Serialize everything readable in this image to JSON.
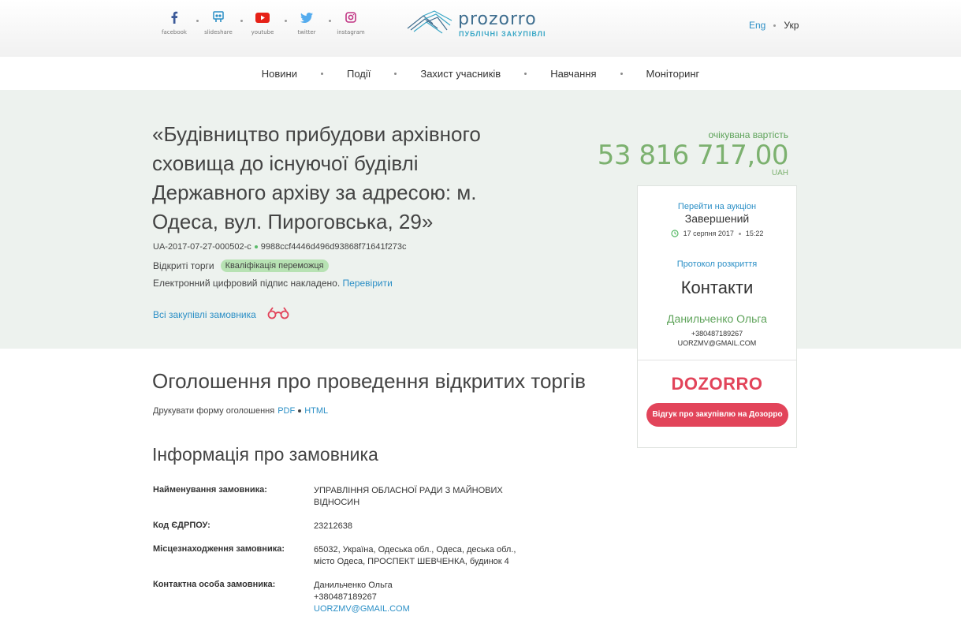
{
  "social": [
    {
      "name": "facebook",
      "label": "facebook",
      "color": "#3b5998"
    },
    {
      "name": "slideshare",
      "label": "slideshare",
      "color": "#2b8fc6"
    },
    {
      "name": "youtube",
      "label": "youtube",
      "color": "#e62117"
    },
    {
      "name": "twitter",
      "label": "twitter",
      "color": "#55acee"
    },
    {
      "name": "instagram",
      "label": "instagram",
      "color": "#c13584"
    }
  ],
  "logo": {
    "word": "prozorro",
    "subtitle": "ПУБЛІЧНІ ЗАКУПІВЛІ"
  },
  "lang": {
    "en": "Eng",
    "uk": "Укр"
  },
  "nav": [
    "Новини",
    "Події",
    "Захист учасників",
    "Навчання",
    "Моніторинг"
  ],
  "tender": {
    "title": "«Будівництво прибудови архівного сховища до існуючої будівлі Державного архіву за адресою: м. Одеса, вул. Пироговська, 29»",
    "id": "UA-2017-07-27-000502-c",
    "hash": "9988ccf4446d496d93868f71641f273c",
    "procedure": "Відкриті торги",
    "status_badge": "Кваліфікація переможця",
    "sign_text": "Електронний цифровий підпис накладено.",
    "sign_link": "Перевірити",
    "all_purchases": "Всі закупівлі замовника",
    "expected_label": "очікувана вартість",
    "expected_value": "53 816 717,00",
    "currency": "UAH"
  },
  "sidebox": {
    "auction_link": "Перейти на аукціон",
    "auction_status": "Завершений",
    "date": "17 серпня 2017",
    "time": "15:22",
    "protocol_link": "Протокол розкриття",
    "contacts_title": "Контакти",
    "contact_name": "Данильченко Ольга",
    "contact_phone": "+380487189267",
    "contact_email": "UORZMV@GMAIL.COM",
    "dozorro": "DOZORRO",
    "dozorro_button": "Відгук про закупівлю на Дозорро"
  },
  "content": {
    "announce_title": "Оголошення про проведення відкритих торгів",
    "print_label": "Друкувати форму оголошення",
    "print_pdf": "PDF",
    "print_html": "HTML",
    "info_title": "Інформація про замовника",
    "rows": [
      {
        "label": "Найменування замовника:",
        "value": "УПРАВЛІННЯ ОБЛАСНОЇ РАДИ З МАЙНОВИХ ВІДНОСИН"
      },
      {
        "label": "Код ЄДРПОУ:",
        "value": "23212638"
      },
      {
        "label": "Місцезнаходження замовника:",
        "value": "65032, Україна, Одеська обл., Одеса, деська обл., місто Одеса, ПРОСПЕКТ ШЕВЧЕНКА, будинок 4"
      },
      {
        "label": "Контактна особа замовника:",
        "value_name": "Данильченко Ольга",
        "value_phone": "+380487189267",
        "value_email": "UORZMV@GMAIL.COM"
      }
    ]
  },
  "colors": {
    "accent_green": "#7cb16f",
    "link_blue": "#2b8fc6",
    "dozorro_red": "#e2445a",
    "hero_bg": "#edf2ee"
  }
}
